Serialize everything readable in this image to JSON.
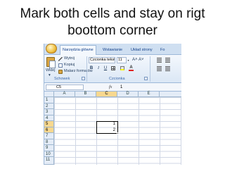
{
  "slide": {
    "title_line1": "Mark both cells and stay on rigt",
    "title_line2": "boottom corner"
  },
  "ribbon": {
    "tabs": [
      "Narzędzia główne",
      "Wstawianie",
      "Układ strony",
      "Fo"
    ],
    "active_tab": "Narzędzia główne",
    "paste_label": "Wklej",
    "cut_label": "Wytnij",
    "copy_label": "Kopiuj",
    "format_painter_label": "Malarz formatów",
    "font_name": "Czcionka tekstu",
    "font_size": "11",
    "bold": "B",
    "italic": "I",
    "underline": "U",
    "groups": [
      "Schowek",
      "Czcionka"
    ]
  },
  "formula_bar": {
    "name_box": "C5",
    "fx_label": "fx",
    "value": "1"
  },
  "sheet": {
    "columns": [
      "A",
      "B",
      "C",
      "D",
      "E"
    ],
    "rows": [
      "1",
      "2",
      "3",
      "4",
      "5",
      "6",
      "7",
      "8",
      "9",
      "10",
      "11"
    ],
    "selected_column": "C",
    "selected_rows": [
      "5",
      "6"
    ],
    "cells": [
      {
        "ref": "C5",
        "value": "1"
      },
      {
        "ref": "C6",
        "value": "2"
      }
    ]
  }
}
